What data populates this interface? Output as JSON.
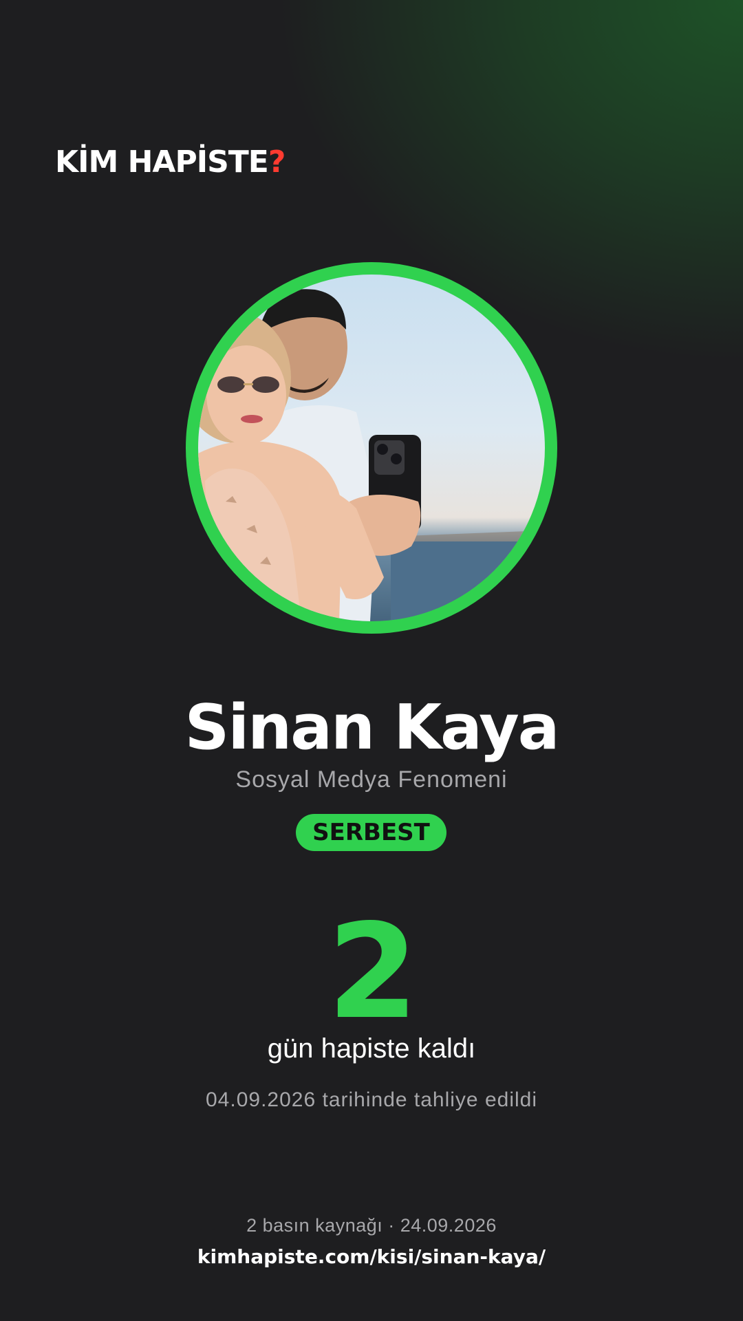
{
  "brand": {
    "logo_text": "KİM HAPİSTE",
    "logo_mark": "?",
    "accent": "#30d14f",
    "logo_mark_color": "#ff3b30",
    "background": "#1e1e20"
  },
  "profile": {
    "photo_icon": "profile-photo",
    "name": "Sinan Kaya",
    "role": "Sosyal Medya Fenomeni",
    "status_badge": "SERBEST"
  },
  "counter": {
    "value": "2",
    "label": "gün hapiste kaldı",
    "release_note": "04.09.2026 tarihinde tahliye edildi"
  },
  "footer": {
    "sources": "2 basın kaynağı · 24.09.2026",
    "url": "kimhapiste.com/kisi/sinan-kaya/"
  }
}
